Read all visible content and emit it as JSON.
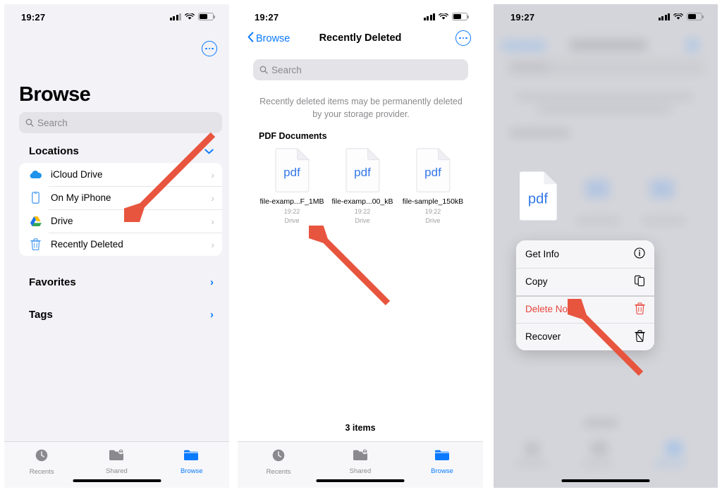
{
  "meta": {
    "accent_blue": "#0a7aff",
    "destructive_red": "#e8453c",
    "arrow_color": "#e8553f",
    "panel_bg": "#f2f2f7"
  },
  "status_bar": {
    "time": "19:27"
  },
  "panel1": {
    "title": "Browse",
    "search": {
      "placeholder": "Search",
      "value": ""
    },
    "more_button_label": "More",
    "sections": [
      {
        "header": "Locations",
        "items": [
          {
            "label": "iCloud Drive",
            "icon": "icloud-drive-icon"
          },
          {
            "label": "On My iPhone",
            "icon": "iphone-icon"
          },
          {
            "label": "Drive",
            "icon": "google-drive-icon"
          },
          {
            "label": "Recently Deleted",
            "icon": "trash-icon"
          }
        ]
      }
    ],
    "links": [
      {
        "label": "Favorites"
      },
      {
        "label": "Tags"
      }
    ],
    "tabs": [
      {
        "label": "Recents",
        "icon": "clock-icon",
        "active": false
      },
      {
        "label": "Shared",
        "icon": "shared-folder-icon",
        "active": false
      },
      {
        "label": "Browse",
        "icon": "folder-icon",
        "active": true
      }
    ]
  },
  "panel2": {
    "back_label": "Browse",
    "title": "Recently Deleted",
    "search": {
      "placeholder": "Search",
      "value": ""
    },
    "notice": "Recently deleted items may be permanently deleted by your storage provider.",
    "group_title": "PDF Documents",
    "files": [
      {
        "name": "file-examp...F_1MB",
        "time": "19:22",
        "source": "Drive",
        "type": "pdf"
      },
      {
        "name": "file-examp...00_kB",
        "time": "19:22",
        "source": "Drive",
        "type": "pdf"
      },
      {
        "name": "file-sample_150kB",
        "time": "19:22",
        "source": "Drive",
        "type": "pdf"
      }
    ],
    "item_count": "3 items",
    "tabs": [
      {
        "label": "Recents",
        "icon": "clock-icon",
        "active": false
      },
      {
        "label": "Shared",
        "icon": "shared-folder-icon",
        "active": false
      },
      {
        "label": "Browse",
        "icon": "folder-icon",
        "active": true
      }
    ]
  },
  "panel3": {
    "selected_file_type": "pdf",
    "context_menu": [
      {
        "label": "Get Info",
        "icon": "info-circle-icon",
        "destructive": false
      },
      {
        "label": "Copy",
        "icon": "copy-icon",
        "destructive": false
      },
      {
        "label": "Delete Now",
        "icon": "trash-icon",
        "destructive": true
      },
      {
        "label": "Recover",
        "icon": "trash-restore-icon",
        "destructive": false
      }
    ]
  },
  "annotations": [
    {
      "name": "arrow-to-recently-deleted",
      "target": "Recently Deleted"
    },
    {
      "name": "arrow-to-file-item",
      "target": "file-examp...F_1MB"
    },
    {
      "name": "arrow-to-recover",
      "target": "Recover"
    }
  ]
}
